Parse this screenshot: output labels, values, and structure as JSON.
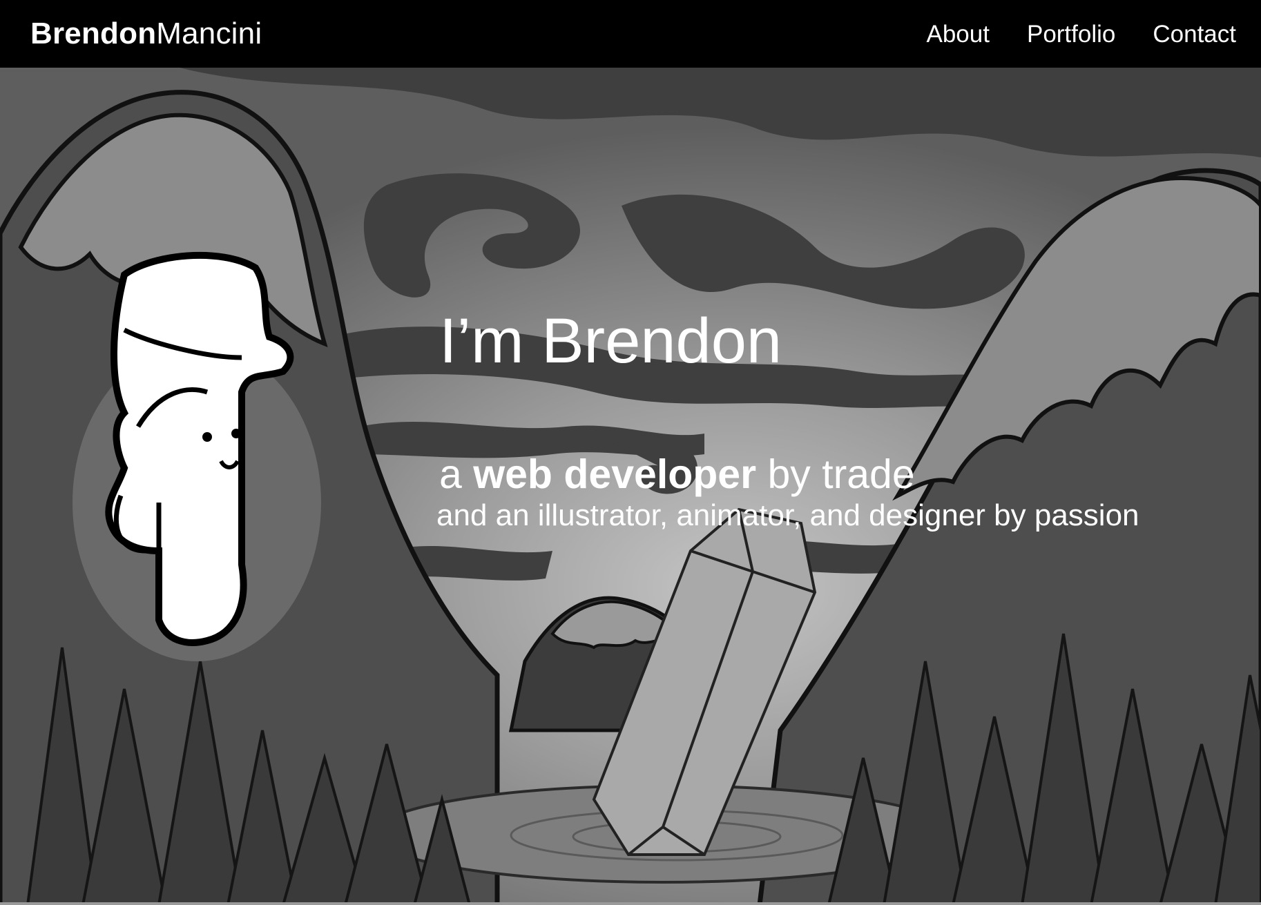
{
  "header": {
    "brand_first": "Brendon",
    "brand_last": "Mancini",
    "nav": [
      {
        "label": "About"
      },
      {
        "label": "Portfolio"
      },
      {
        "label": "Contact"
      }
    ]
  },
  "hero": {
    "greeting": "I’m Brendon",
    "tagline_pre": "a ",
    "tagline_strong": "web developer",
    "tagline_post": " by trade",
    "subline": "and an illustrator, animator, and designer by passion",
    "illustration_icon": "mountain-landscape-with-crystal",
    "avatar_icon": "cartoon-character-avatar"
  },
  "colors": {
    "header_bg": "#000000",
    "text": "#ffffff",
    "sky": "#8a8a8a",
    "mountain": "#4d4d4d"
  }
}
